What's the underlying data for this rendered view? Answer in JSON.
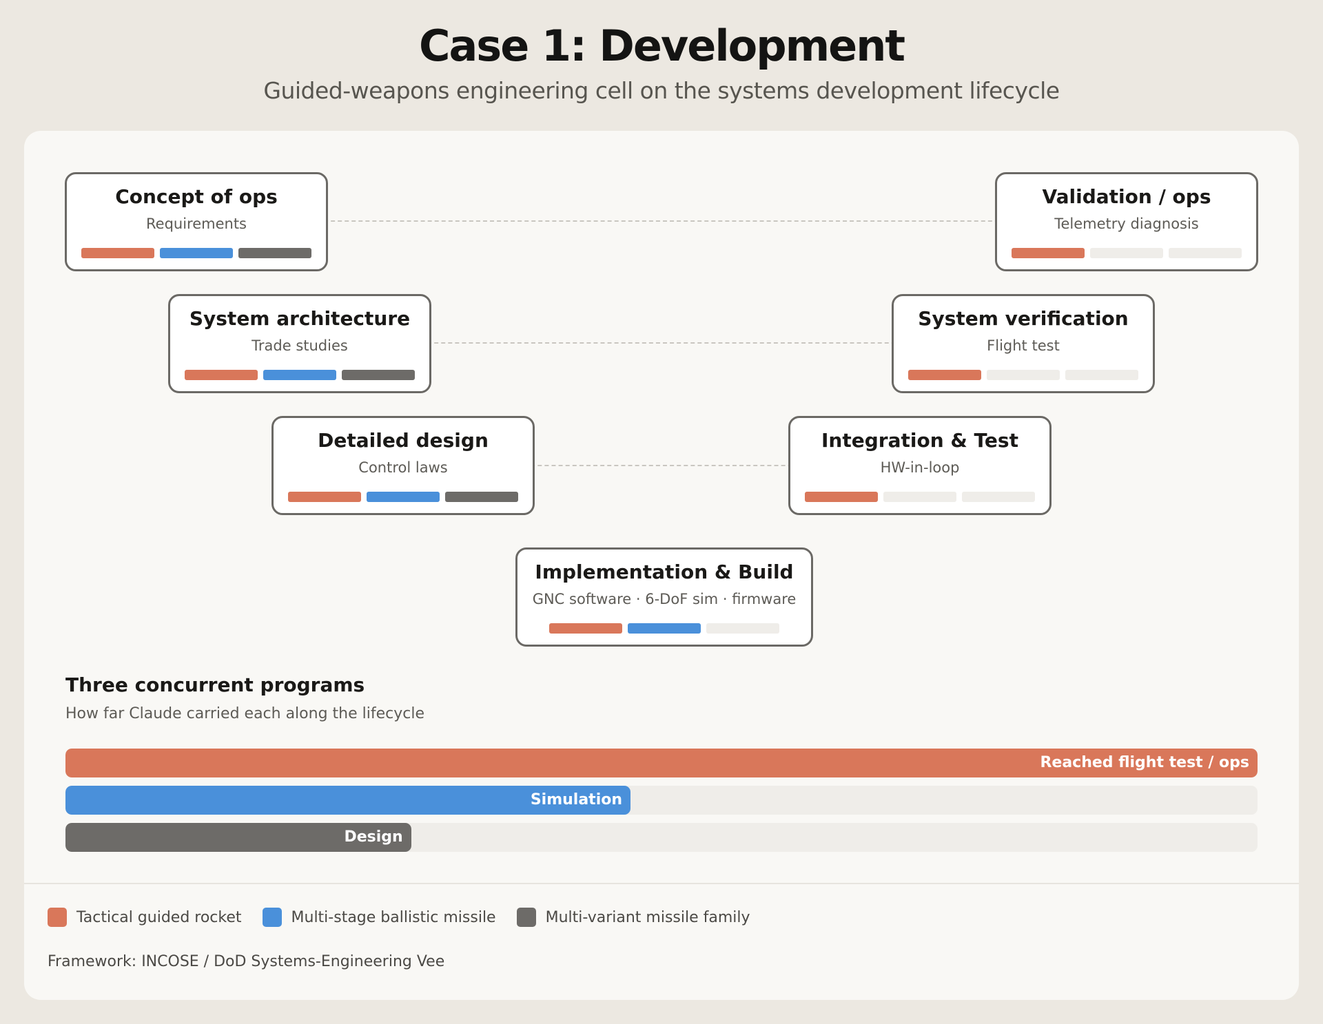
{
  "header": {
    "title": "Case 1: Development",
    "subtitle": "Guided-weapons engineering cell on the systems development lifecycle"
  },
  "colors": {
    "rocket": "#D9775A",
    "ballistic": "#4A90DA",
    "family": "#6D6B68",
    "empty": "#EFEDE9"
  },
  "vee": {
    "stages": [
      {
        "title": "Concept of ops",
        "subtitle": "Requirements",
        "programs_covered": [
          true,
          true,
          true
        ]
      },
      {
        "title": "System architecture",
        "subtitle": "Trade studies",
        "programs_covered": [
          true,
          true,
          true
        ]
      },
      {
        "title": "Detailed design",
        "subtitle": "Control laws",
        "programs_covered": [
          true,
          true,
          true
        ]
      },
      {
        "title": "Implementation & Build",
        "subtitle": "GNC software · 6-DoF sim · firmware",
        "programs_covered": [
          true,
          true,
          false
        ]
      },
      {
        "title": "Integration & Test",
        "subtitle": "HW-in-loop",
        "programs_covered": [
          true,
          false,
          false
        ]
      },
      {
        "title": "System verification",
        "subtitle": "Flight test",
        "programs_covered": [
          true,
          false,
          false
        ]
      },
      {
        "title": "Validation / ops",
        "subtitle": "Telemetry diagnosis",
        "programs_covered": [
          true,
          false,
          false
        ]
      }
    ]
  },
  "programs": {
    "title": "Three concurrent programs",
    "subtitle": "How far Claude carried each along the lifecycle",
    "bars": [
      {
        "label": "Reached flight test / ops",
        "progress": 1.0,
        "color": "#D9775A"
      },
      {
        "label": "Simulation",
        "progress": 0.474,
        "color": "#4A90DA"
      },
      {
        "label": "Design",
        "progress": 0.29,
        "color": "#6D6B68"
      }
    ]
  },
  "legend": [
    {
      "label": "Tactical guided rocket",
      "color": "#D9775A"
    },
    {
      "label": "Multi-stage ballistic missile",
      "color": "#4A90DA"
    },
    {
      "label": "Multi-variant missile family",
      "color": "#6D6B68"
    }
  ],
  "footnote": "Framework: INCOSE / DoD Systems-Engineering Vee"
}
